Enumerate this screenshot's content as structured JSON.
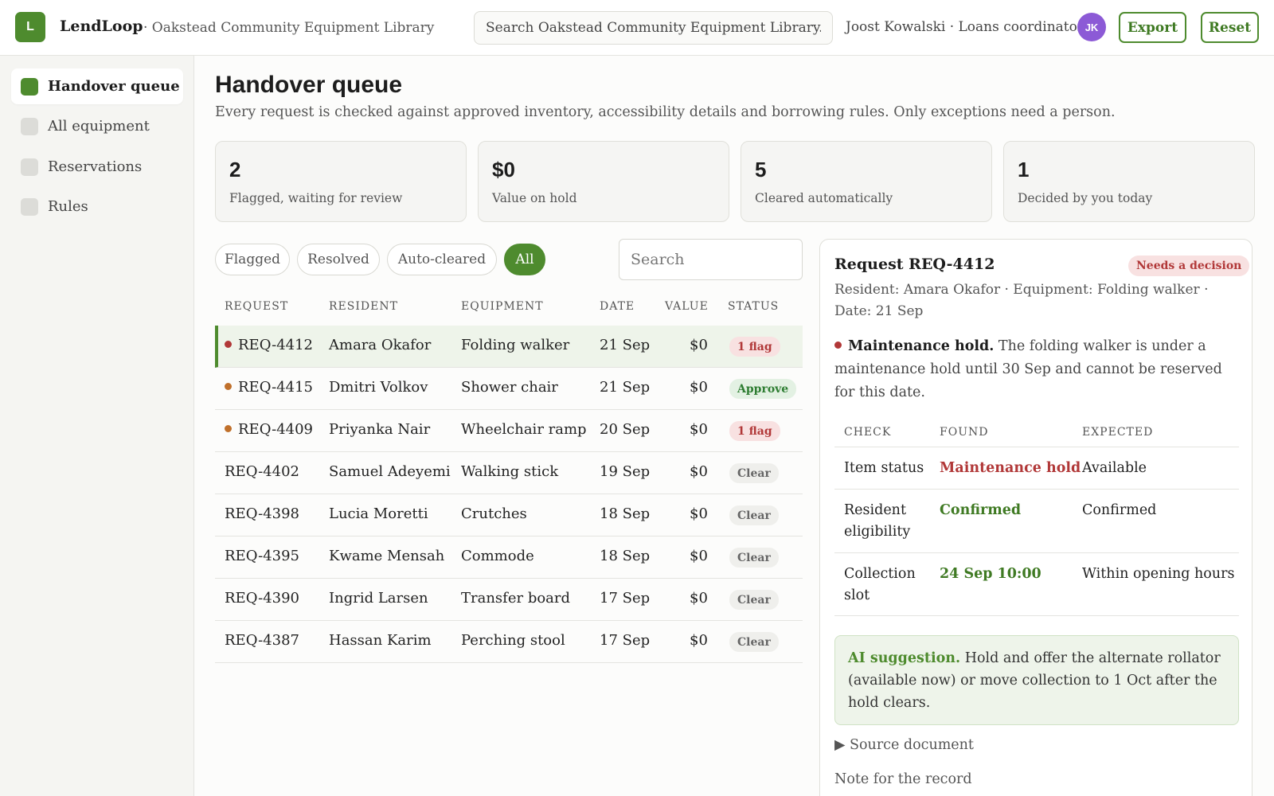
{
  "app": {
    "logo_letter": "L",
    "brand": "LendLoop",
    "org": "· Oakstead Community Equipment Library",
    "search_placeholder": "Search Oakstead Community Equipment Library...",
    "user": "Joost Kowalski · Loans coordinator",
    "avatar_initials": "JK",
    "export_label": "Export",
    "reset_label": "Reset",
    "accent_color": "#4e8b2e"
  },
  "sidebar": {
    "items": [
      {
        "label": "Handover queue",
        "active": true
      },
      {
        "label": "All equipment",
        "active": false
      },
      {
        "label": "Reservations",
        "active": false
      },
      {
        "label": "Rules",
        "active": false
      }
    ]
  },
  "main": {
    "title": "Handover queue",
    "subtitle": "Every request is checked against approved inventory, accessibility details and borrowing rules. Only exceptions need a person.",
    "stats": [
      {
        "value": "2",
        "label": "Flagged, waiting for review"
      },
      {
        "value": "$0",
        "label": "Value on hold"
      },
      {
        "value": "5",
        "label": "Cleared automatically"
      },
      {
        "value": "1",
        "label": "Decided by you today"
      }
    ],
    "filters": [
      {
        "label": "Flagged",
        "active": false
      },
      {
        "label": "Resolved",
        "active": false
      },
      {
        "label": "Auto-cleared",
        "active": false
      },
      {
        "label": "All",
        "active": true
      }
    ],
    "table_search_placeholder": "Search"
  },
  "table": {
    "headers": [
      "REQUEST",
      "RESIDENT",
      "EQUIPMENT",
      "DATE",
      "VALUE",
      "STATUS"
    ],
    "rows": [
      {
        "id": "REQ-4412",
        "resident": "Amara Okafor",
        "equipment": "Folding walker",
        "date": "21 Sep",
        "value": "$0",
        "status": "1 flag",
        "dot": "#b13838"
      },
      {
        "id": "REQ-4415",
        "resident": "Dmitri Volkov",
        "equipment": "Shower chair",
        "date": "21 Sep",
        "value": "$0",
        "status": "Approve",
        "dot": "#c0702b"
      },
      {
        "id": "REQ-4409",
        "resident": "Priyanka Nair",
        "equipment": "Wheelchair ramp",
        "date": "20 Sep",
        "value": "$0",
        "status": "1 flag",
        "dot": "#c0702b"
      },
      {
        "id": "REQ-4402",
        "resident": "Samuel Adeyemi",
        "equipment": "Walking stick",
        "date": "19 Sep",
        "value": "$0",
        "status": "Clear",
        "dot": ""
      },
      {
        "id": "REQ-4398",
        "resident": "Lucia Moretti",
        "equipment": "Crutches",
        "date": "18 Sep",
        "value": "$0",
        "status": "Clear",
        "dot": ""
      },
      {
        "id": "REQ-4395",
        "resident": "Kwame Mensah",
        "equipment": "Commode",
        "date": "18 Sep",
        "value": "$0",
        "status": "Clear",
        "dot": ""
      },
      {
        "id": "REQ-4390",
        "resident": "Ingrid Larsen",
        "equipment": "Transfer board",
        "date": "17 Sep",
        "value": "$0",
        "status": "Clear",
        "dot": ""
      },
      {
        "id": "REQ-4387",
        "resident": "Hassan Karim",
        "equipment": "Perching stool",
        "date": "17 Sep",
        "value": "$0",
        "status": "Clear",
        "dot": ""
      }
    ]
  },
  "detail": {
    "title": "Request REQ-4412",
    "badge": "Needs a decision",
    "meta": "Resident: Amara Okafor · Equipment: Folding walker · Date: 21 Sep",
    "hold_title": "Maintenance hold.",
    "hold_text": " The folding walker is under a maintenance hold until 30 Sep and cannot be reserved for this date.",
    "check_headers": [
      "CHECK",
      "FOUND",
      "EXPECTED"
    ],
    "checks": [
      {
        "check": "Item status",
        "found": "Maintenance hold",
        "expected": "Available"
      },
      {
        "check": "Resident eligibility",
        "found": "Confirmed",
        "expected": "Confirmed"
      },
      {
        "check": "Collection slot",
        "found": "24 Sep 10:00",
        "expected": "Within opening hours"
      }
    ],
    "ai_label": "AI suggestion.",
    "ai_text": " Hold and offer the alternate rollator (available now) or move collection to 1 Oct after the hold clears.",
    "source_label": "▶ Source document",
    "note_label": "Note for the record"
  }
}
